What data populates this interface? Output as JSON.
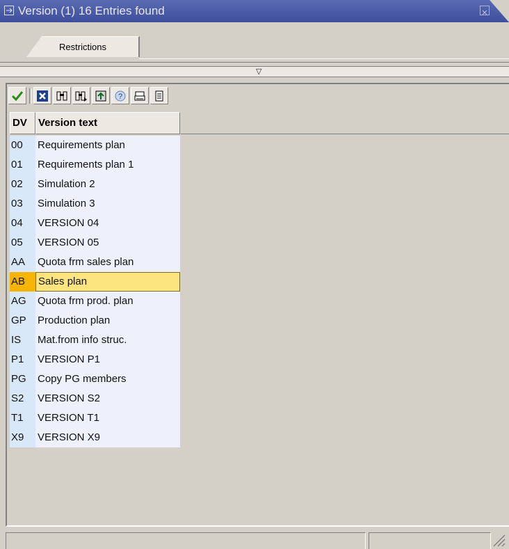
{
  "window": {
    "title": "Version (1)   16 Entries found"
  },
  "tabs": [
    {
      "label": "Restrictions"
    }
  ],
  "toolbar": {
    "icons": [
      "check-icon",
      "cancel-icon",
      "find-icon",
      "find-next-icon",
      "sort-icon",
      "help-icon",
      "print-icon",
      "list-icon"
    ]
  },
  "table": {
    "headers": {
      "key": "DV",
      "text": "Version text"
    },
    "rows": [
      {
        "key": "00",
        "text": "Requirements plan"
      },
      {
        "key": "01",
        "text": "Requirements plan 1"
      },
      {
        "key": "02",
        "text": "Simulation 2"
      },
      {
        "key": "03",
        "text": "Simulation 3"
      },
      {
        "key": "04",
        "text": "VERSION 04"
      },
      {
        "key": "05",
        "text": "VERSION 05"
      },
      {
        "key": "AA",
        "text": "Quota frm sales plan"
      },
      {
        "key": "AB",
        "text": "Sales plan"
      },
      {
        "key": "AG",
        "text": "Quota frm prod. plan"
      },
      {
        "key": "GP",
        "text": "Production plan"
      },
      {
        "key": "IS",
        "text": "Mat.from info struc."
      },
      {
        "key": "P1",
        "text": "VERSION P1"
      },
      {
        "key": "PG",
        "text": "Copy PG members"
      },
      {
        "key": "S2",
        "text": "VERSION S2"
      },
      {
        "key": "T1",
        "text": "VERSION T1"
      },
      {
        "key": "X9",
        "text": "VERSION X9"
      }
    ],
    "selected_key": "AB"
  },
  "colors": {
    "titlebar": "#3f4e9c",
    "selection": "#fce57e",
    "key_column": "#d8e8f8"
  }
}
